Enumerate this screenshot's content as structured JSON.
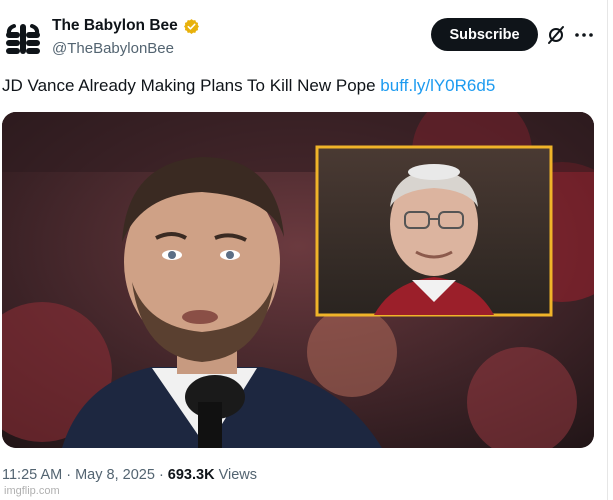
{
  "header": {
    "subscribe_label": "Subscribe"
  },
  "tweet": {
    "author": {
      "display_name": "The Babylon Bee",
      "handle": "@TheBabylonBee",
      "verified_color": "#e8b10b"
    },
    "text": "JD Vance Already Making Plans To Kill New Pope ",
    "link_text": "buff.ly/lY0R6d5",
    "time": "11:25 AM",
    "separator": " · ",
    "date": "May 8, 2025",
    "views_count": "693.3K",
    "views_label": " Views"
  },
  "icons": [
    "bee-logo-avatar",
    "verified-badge-icon",
    "grok-icon",
    "more-options-icon"
  ],
  "colors": {
    "link": "#1d9bf0",
    "subscribe_bg": "#0f1419",
    "inset_border": "#f0b429",
    "secondary_text": "#536471"
  },
  "watermark": "imgflip.com"
}
